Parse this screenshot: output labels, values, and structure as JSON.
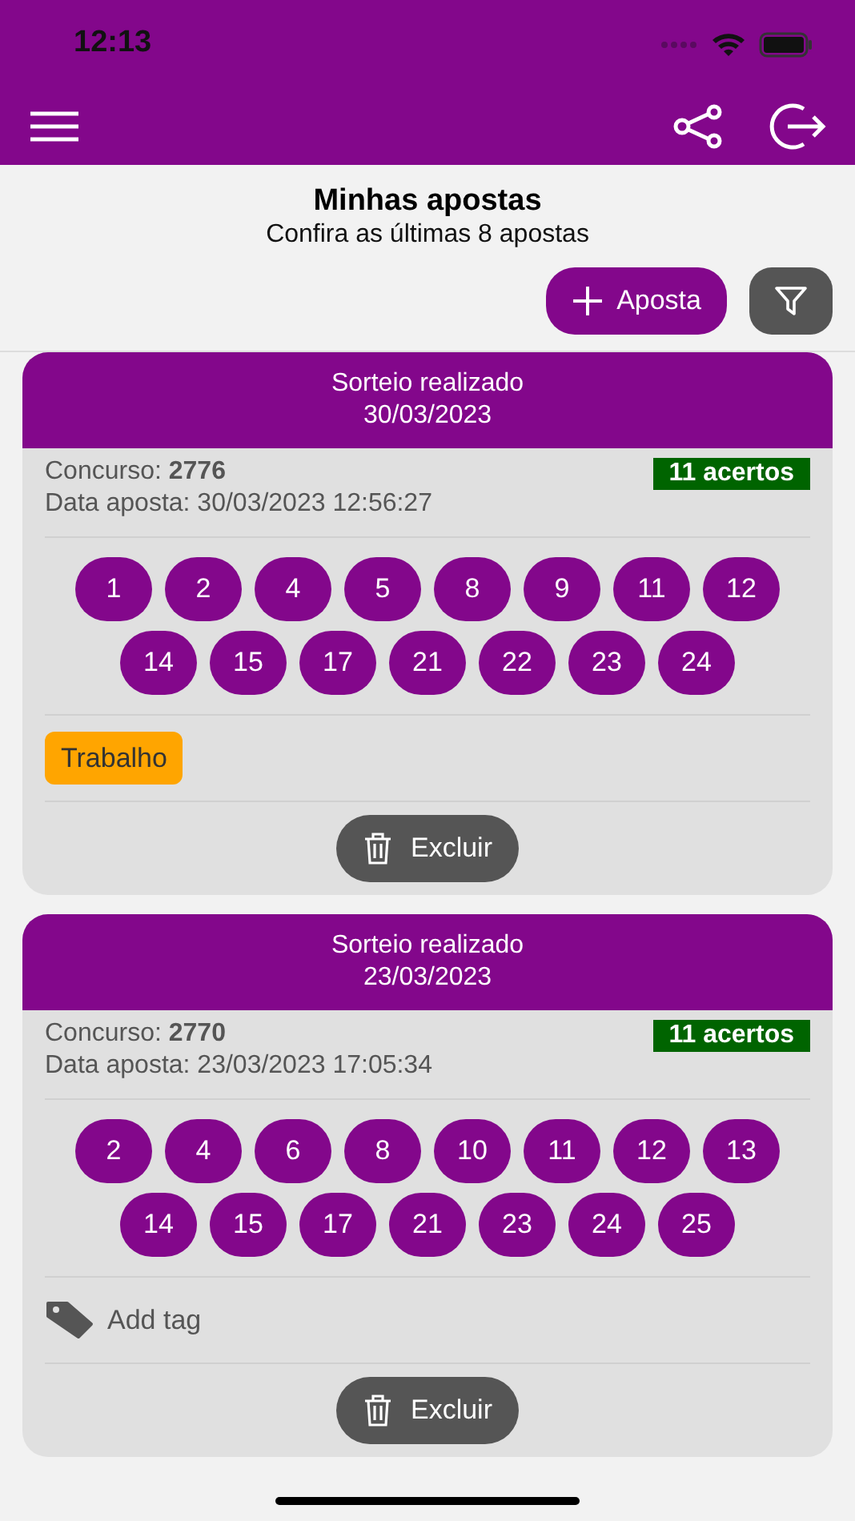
{
  "status_bar": {
    "time": "12:13"
  },
  "header": {
    "title": "Minhas apostas",
    "subtitle": "Confira as últimas 8 apostas"
  },
  "actions": {
    "new_bet": "Aposta"
  },
  "bets": [
    {
      "status": "Sorteio realizado",
      "draw_date": "30/03/2023",
      "contest_label": "Concurso:",
      "contest": "2776",
      "bet_date": "Data aposta: 30/03/2023 12:56:27",
      "hits": "11 acertos",
      "numbers": [
        "1",
        "2",
        "4",
        "5",
        "8",
        "9",
        "11",
        "12",
        "14",
        "15",
        "17",
        "21",
        "22",
        "23",
        "24"
      ],
      "tag": {
        "kind": "tag",
        "label": "Trabalho",
        "color": "#ffa500"
      },
      "delete": "Excluir"
    },
    {
      "status": "Sorteio realizado",
      "draw_date": "23/03/2023",
      "contest_label": "Concurso:",
      "contest": "2770",
      "bet_date": "Data aposta: 23/03/2023 17:05:34",
      "hits": "11 acertos",
      "numbers": [
        "2",
        "4",
        "6",
        "8",
        "10",
        "11",
        "12",
        "13",
        "14",
        "15",
        "17",
        "21",
        "23",
        "24",
        "25"
      ],
      "tag": {
        "kind": "add",
        "label": "Add tag"
      },
      "delete": "Excluir"
    }
  ]
}
